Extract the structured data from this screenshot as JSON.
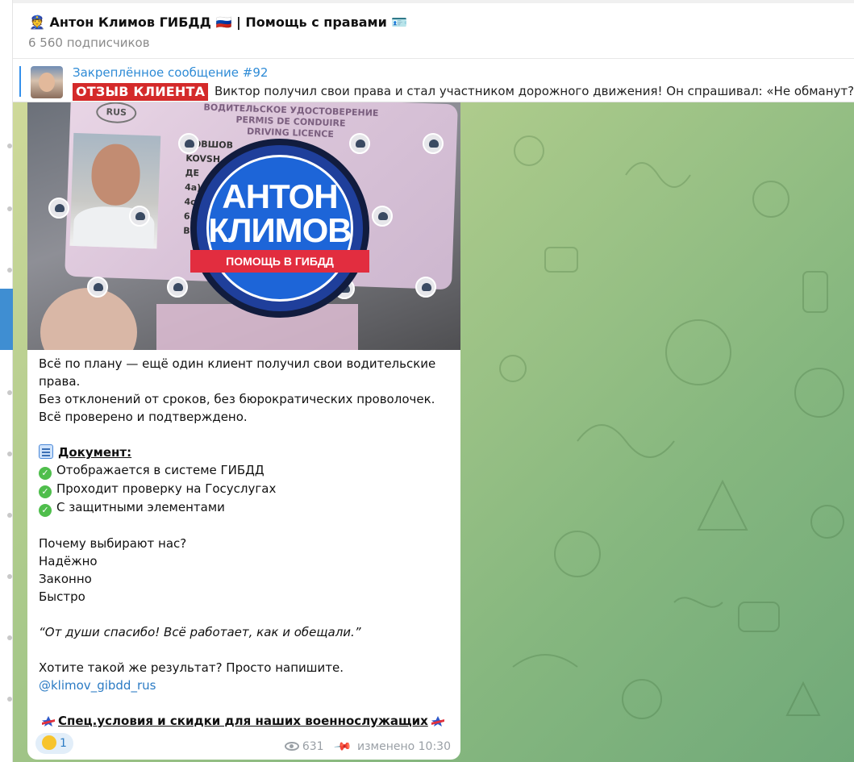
{
  "header": {
    "title_prefix_emoji": "👮",
    "title": "Антон Климов ГИБДД",
    "flag_emoji": "🇷🇺",
    "separator": "|",
    "subtitle": "Помощь с правами",
    "card_emoji": "🪪",
    "subscribers": "6 560 подписчиков"
  },
  "pinned": {
    "title": "Закреплённое сообщение #92",
    "badge": "ОТЗЫВ КЛИЕНТА",
    "preview": "Виктор получил свои права и стал участником дорожного движения!  Он спрашивал: «Не обманут? Э"
  },
  "photo": {
    "license_country": "RUS",
    "license_header": [
      "ВОДИТЕЛЬСКОЕ УДОСТОВЕРЕНИЕ",
      "PERMIS DE CONDUIRE",
      "DRIVING LICENCE"
    ],
    "license_lines": [
      "КОВШОВ",
      "KOVSH",
      "ДЕ",
      "",
      "",
      "4a)",
      "4c)",
      "",
      "6.",
      "B B"
    ],
    "logo_line1": "АНТОН",
    "logo_line2": "КЛИМОВ",
    "logo_ribbon": "ПОМОЩЬ В ГИБДД"
  },
  "message": {
    "intro1": "Всё по плану — ещё один клиент получил свои водительские права.",
    "intro2": "Без отклонений от сроков, без бюрократических проволочек.",
    "intro3": "Всё проверено и подтверждено.",
    "doc_heading": "Документ:",
    "checks": [
      "Отображается в системе ГИБДД",
      "Проходит проверку на Госуслугах",
      "С защитными элементами"
    ],
    "why": "Почему выбирают нас?",
    "reasons": [
      "Надёжно",
      "Законно",
      "Быстро"
    ],
    "quote": "“От души спасибо! Всё работает, как и обещали.”",
    "cta": "Хотите такой же результат? Просто напишите.",
    "handle": "@klimov_gibdd_rus",
    "special": "Спец.условия и скидки для наших военнослужащих"
  },
  "footer": {
    "reaction_count": "1",
    "views": "631",
    "edited": "изменено 10:30"
  },
  "colors": {
    "accent": "#3390ec",
    "badge": "#d42a2a",
    "link": "#2b7bc4",
    "check": "#4fbe4c"
  }
}
